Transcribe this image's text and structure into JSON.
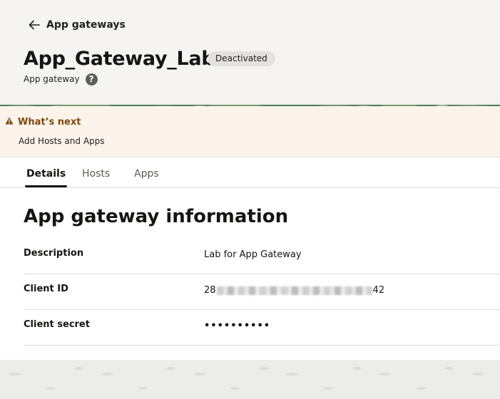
{
  "header": {
    "back_label": "App gateways",
    "title": "App_Gateway_Lab",
    "status_badge": "Deactivated",
    "subtitle": "App gateway",
    "help_glyph": "?"
  },
  "whats_next": {
    "title": "What’s next",
    "action": "Add Hosts and Apps",
    "accent_color": "#7a4a10"
  },
  "tabs": [
    {
      "label": "Details",
      "active": true
    },
    {
      "label": "Hosts",
      "active": false
    },
    {
      "label": "Apps",
      "active": false
    }
  ],
  "info": {
    "heading": "App gateway information",
    "rows": [
      {
        "label": "Description",
        "value": "Lab for App Gateway"
      },
      {
        "label": "Client ID",
        "value_prefix": "28",
        "value_suffix": "42"
      },
      {
        "label": "Client secret",
        "value": "••••••••••"
      }
    ]
  }
}
